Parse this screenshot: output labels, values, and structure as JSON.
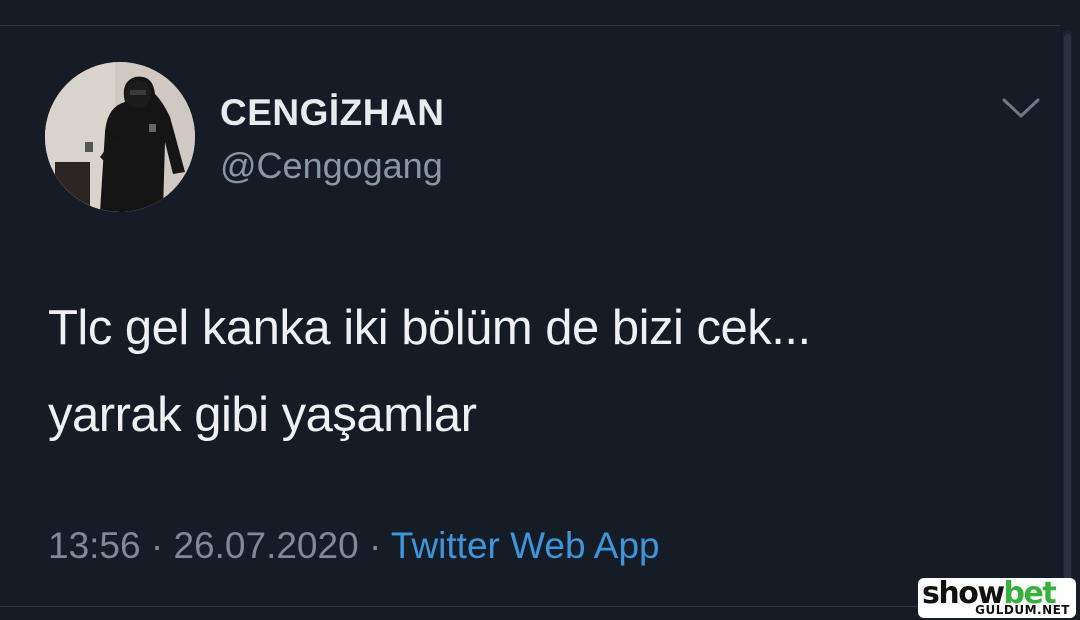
{
  "tweet": {
    "author": {
      "display_name": "CENGİZHAN",
      "handle": "@Cengogang",
      "avatar": "avatar-photo"
    },
    "menu_icon": "chevron-down-icon",
    "text_lines": [
      "Tlc gel kanka iki bölüm de bizi cek...",
      "yarrak gibi yaşamlar"
    ],
    "time": "13:56",
    "separator": "·",
    "date": "26.07.2020",
    "source": "Twitter Web App"
  },
  "watermark": {
    "brand_part1": "show",
    "brand_part2": "bet",
    "site": "GULDUM.NET"
  },
  "colors": {
    "background": "#151c25",
    "text_primary": "#eef0f2",
    "text_secondary": "#8a96a2",
    "link": "#3d96db",
    "accent_green": "#35b23a"
  }
}
